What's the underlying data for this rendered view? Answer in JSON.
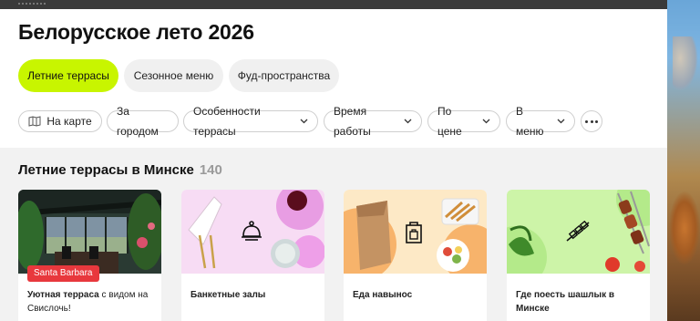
{
  "page": {
    "title": "Белорусское лето 2026"
  },
  "tabs": [
    {
      "label": "Летние террасы",
      "active": true
    },
    {
      "label": "Сезонное меню",
      "active": false
    },
    {
      "label": "Фуд-пространства",
      "active": false
    }
  ],
  "filters": {
    "map": "На карте",
    "outside": "За городом",
    "features": "Особенности террасы",
    "hours": "Время работы",
    "price": "По цене",
    "menu": "В меню",
    "more_icon": "more-dots-icon"
  },
  "section": {
    "title": "Летние террасы в Минске",
    "count": "140"
  },
  "cards": [
    {
      "badge": "Santa Barbara",
      "caption_bold": "Уютная терраса",
      "caption_rest": " с видом на Свислочь!"
    },
    {
      "caption_bold": "Банкетные залы",
      "icon": "cloche-icon"
    },
    {
      "caption_bold": "Еда навынос",
      "icon": "takeaway-bag-icon"
    },
    {
      "caption_bold": "Где поесть шашлык в Минске",
      "icon": "skewer-icon"
    }
  ],
  "colors": {
    "accent": "#c8f500",
    "badge": "#e8383d"
  }
}
